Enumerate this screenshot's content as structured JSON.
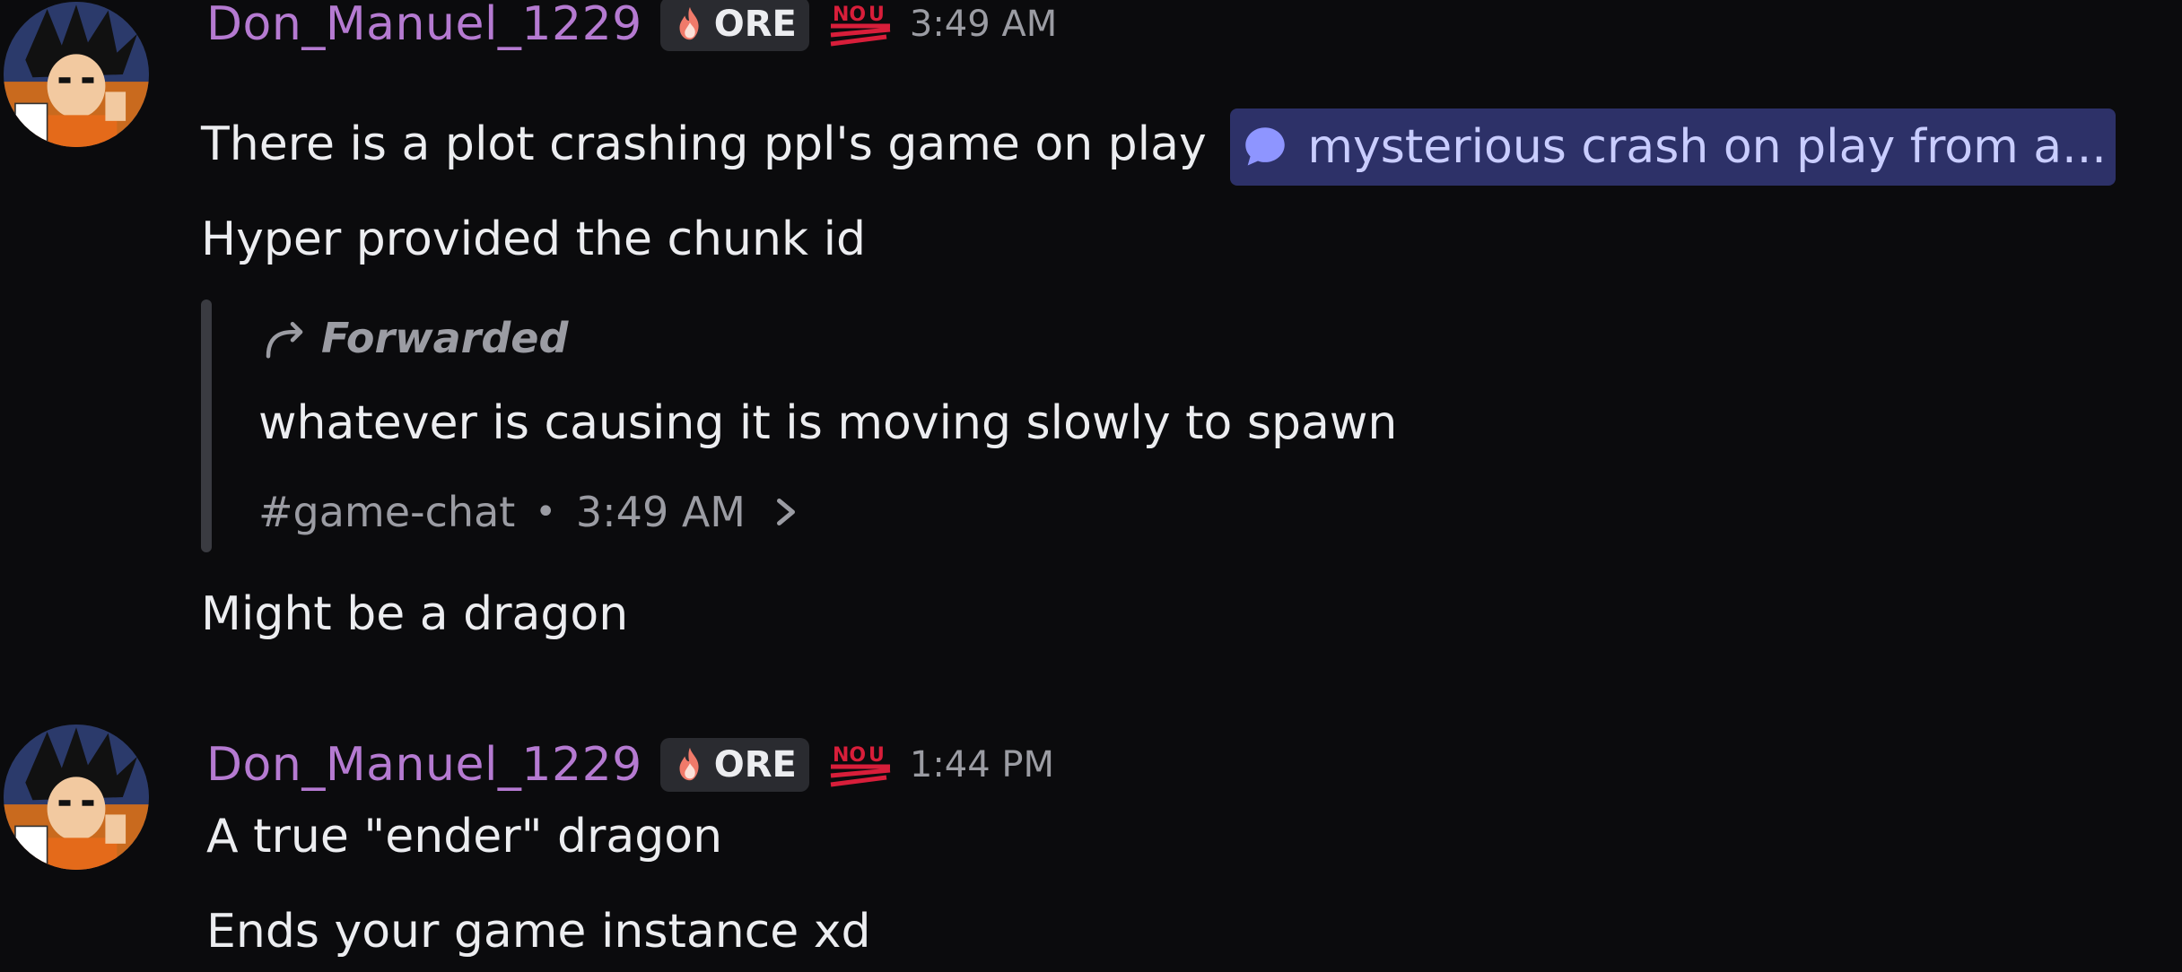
{
  "messages": [
    {
      "author": "Don_Manuel_1229",
      "tag": "ORE",
      "timestamp": "3:49 AM",
      "lines": {
        "line1_text": "There is a plot crashing ppl's game on play",
        "line1_channel": "mysterious crash on play from a...",
        "line2": "Hyper provided the chunk id",
        "line3": "Might be a dragon"
      },
      "forwarded": {
        "label": "Forwarded",
        "text": "whatever is causing it is moving slowly to spawn",
        "channel": "#game-chat",
        "separator": "•",
        "time": "3:49 AM"
      }
    },
    {
      "author": "Don_Manuel_1229",
      "tag": "ORE",
      "timestamp": "1:44 PM",
      "lines": {
        "line1": "A true \"ender\" dragon",
        "line2": "Ends your game instance xd"
      }
    }
  ],
  "icons": {
    "avatar": "anime-avatar",
    "tag_icon": "flame-icon",
    "badge": "nou-icon",
    "thread": "thread-bubble-icon",
    "forward": "forward-arrow-icon",
    "chevron": "chevron-right-icon"
  },
  "colors": {
    "background": "#0b0b0d",
    "username": "#b57ad1",
    "channel_pill_bg": "#2d3168",
    "channel_pill_text": "#c9cdff",
    "muted": "#9b9ca3",
    "nou_red": "#d81e3a"
  }
}
